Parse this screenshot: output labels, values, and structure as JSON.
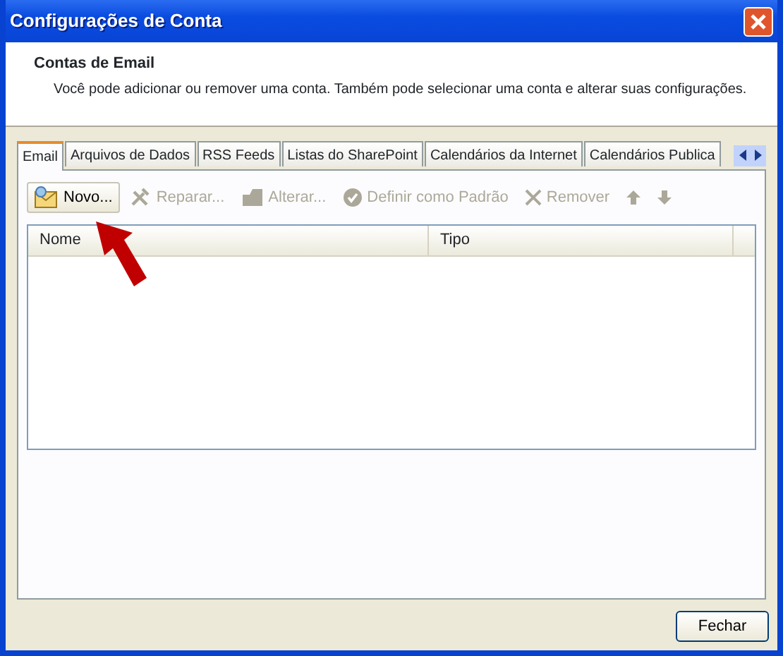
{
  "window": {
    "title": "Configurações de Conta"
  },
  "header": {
    "title": "Contas de Email",
    "description": "Você pode adicionar ou remover uma conta. Também pode selecionar uma conta e alterar suas configurações."
  },
  "tabs": [
    {
      "label": "Email",
      "selected": true
    },
    {
      "label": "Arquivos de Dados",
      "selected": false
    },
    {
      "label": "RSS Feeds",
      "selected": false
    },
    {
      "label": "Listas do SharePoint",
      "selected": false
    },
    {
      "label": "Calendários da Internet",
      "selected": false
    },
    {
      "label": "Calendários Publica",
      "selected": false
    }
  ],
  "toolbar": [
    {
      "kind": "new",
      "label": "Novo...",
      "disabled": false
    },
    {
      "kind": "repair",
      "label": "Reparar...",
      "disabled": true
    },
    {
      "kind": "change",
      "label": "Alterar...",
      "disabled": true
    },
    {
      "kind": "default",
      "label": "Definir como Padrão",
      "disabled": true
    },
    {
      "kind": "remove",
      "label": "Remover",
      "disabled": true
    },
    {
      "kind": "up",
      "disabled": true
    },
    {
      "kind": "down",
      "disabled": true
    }
  ],
  "table": {
    "columns": [
      "Nome",
      "Tipo"
    ]
  },
  "buttons": [
    "Fechar"
  ]
}
